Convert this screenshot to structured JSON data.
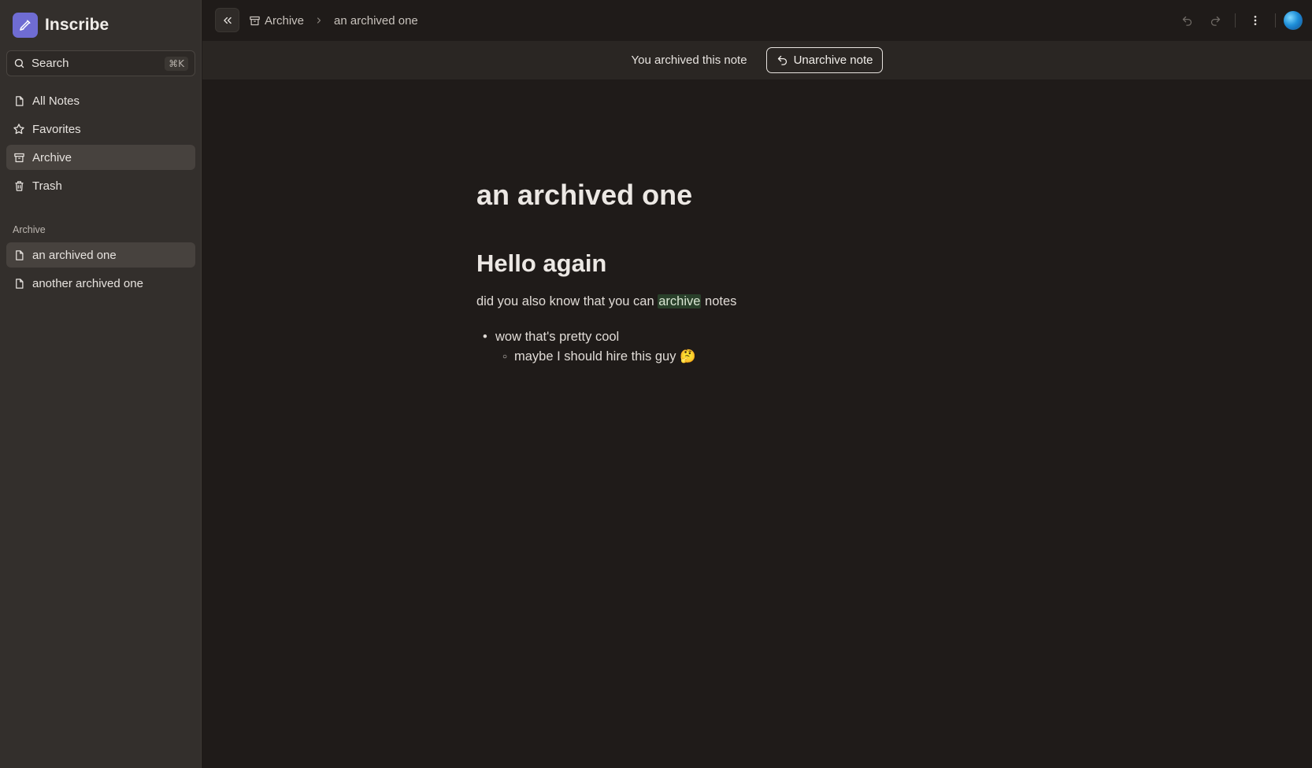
{
  "app": {
    "name": "Inscribe"
  },
  "search": {
    "label": "Search",
    "shortcut": "⌘K"
  },
  "nav": [
    {
      "label": "All Notes",
      "icon": "file-icon",
      "active": false
    },
    {
      "label": "Favorites",
      "icon": "star-icon",
      "active": false
    },
    {
      "label": "Archive",
      "icon": "archive-icon",
      "active": true
    },
    {
      "label": "Trash",
      "icon": "trash-icon",
      "active": false
    }
  ],
  "archive_section": {
    "label": "Archive",
    "notes": [
      {
        "label": "an archived one",
        "active": true
      },
      {
        "label": "another archived one",
        "active": false
      }
    ]
  },
  "breadcrumb": {
    "parent": "Archive",
    "current": "an archived one"
  },
  "banner": {
    "text": "You archived this note",
    "button": "Unarchive note"
  },
  "document": {
    "title": "an archived one",
    "heading": "Hello again",
    "paragraph_before": "did you also know that you can ",
    "paragraph_highlight": "archive",
    "paragraph_after": " notes",
    "bullet": "wow that's pretty cool",
    "sub_bullet": "maybe I should hire this guy 🤔"
  },
  "colors": {
    "background": "#1f1b19",
    "sidebar": "#332f2c",
    "accent": "#6f6cd3",
    "highlight": "#29402a"
  }
}
